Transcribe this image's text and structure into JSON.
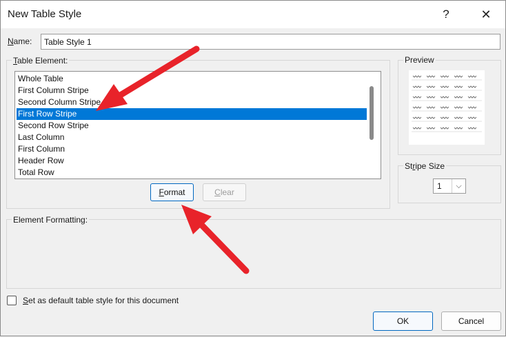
{
  "window": {
    "title": "New Table Style",
    "help_glyph": "?",
    "close_glyph": "✕"
  },
  "name_field": {
    "label_accesskey": "N",
    "label_rest": "ame:",
    "value": "Table Style 1"
  },
  "table_element": {
    "label_accesskey": "T",
    "label_rest": "able Element:",
    "items": [
      {
        "label": "Whole Table",
        "selected": false
      },
      {
        "label": "First Column Stripe",
        "selected": false
      },
      {
        "label": "Second Column Stripe",
        "selected": false
      },
      {
        "label": "First Row Stripe",
        "selected": true
      },
      {
        "label": "Second Row Stripe",
        "selected": false
      },
      {
        "label": "Last Column",
        "selected": false
      },
      {
        "label": "First Column",
        "selected": false
      },
      {
        "label": "Header Row",
        "selected": false
      },
      {
        "label": "Total Row",
        "selected": false
      }
    ]
  },
  "buttons": {
    "format_accesskey": "F",
    "format_rest": "ormat",
    "clear_accesskey": "C",
    "clear_rest": "lear",
    "ok": "OK",
    "cancel": "Cancel"
  },
  "preview": {
    "label": "Preview",
    "rows": 6,
    "cols": 5
  },
  "stripe_size": {
    "label_pre": "St",
    "label_accesskey": "r",
    "label_post": "ipe Size",
    "value": "1",
    "arrow_glyph": "⌵"
  },
  "element_formatting": {
    "label": "Element Formatting:"
  },
  "default_checkbox": {
    "checked": false,
    "label_accesskey": "S",
    "label_rest": "et as default table style for this document"
  },
  "annotation_color": "#e8232a",
  "selection_color": "#0078d7"
}
